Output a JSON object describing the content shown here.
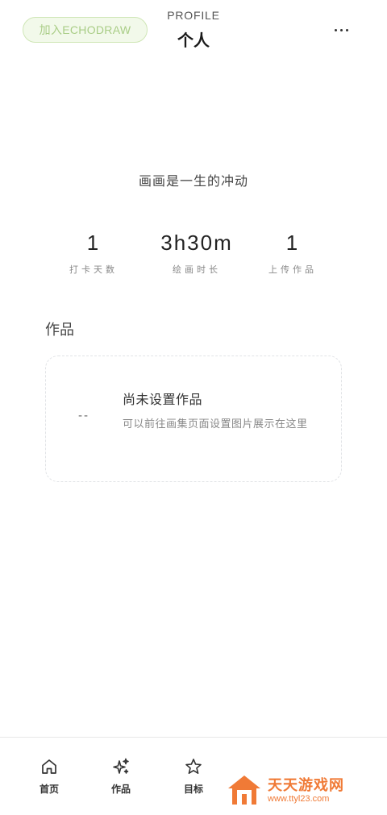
{
  "header": {
    "join_button": "加入ECHODRAW",
    "eyebrow": "PROFILE",
    "title": "个人",
    "more_icon": "more-horizontal-icon"
  },
  "profile": {
    "motto": "画画是一生的冲动",
    "stats": [
      {
        "value": "1",
        "label": "打卡天数"
      },
      {
        "value": "3h30m",
        "label": "绘画时长"
      },
      {
        "value": "1",
        "label": "上传作品"
      }
    ]
  },
  "works": {
    "section_title": "作品",
    "placeholder_text": "--",
    "empty_title": "尚未设置作品",
    "empty_description": "可以前往画集页面设置图片展示在这里"
  },
  "bottom_nav": {
    "items": [
      {
        "label": "首页",
        "icon": "home-icon"
      },
      {
        "label": "作品",
        "icon": "sparkles-icon"
      },
      {
        "label": "目标",
        "icon": "star-icon"
      }
    ]
  },
  "watermark": {
    "name": "天天游戏网",
    "url": "www.ttyl23.com"
  },
  "colors": {
    "accent_green": "#a9cd86",
    "watermark_orange": "#f07a36"
  }
}
